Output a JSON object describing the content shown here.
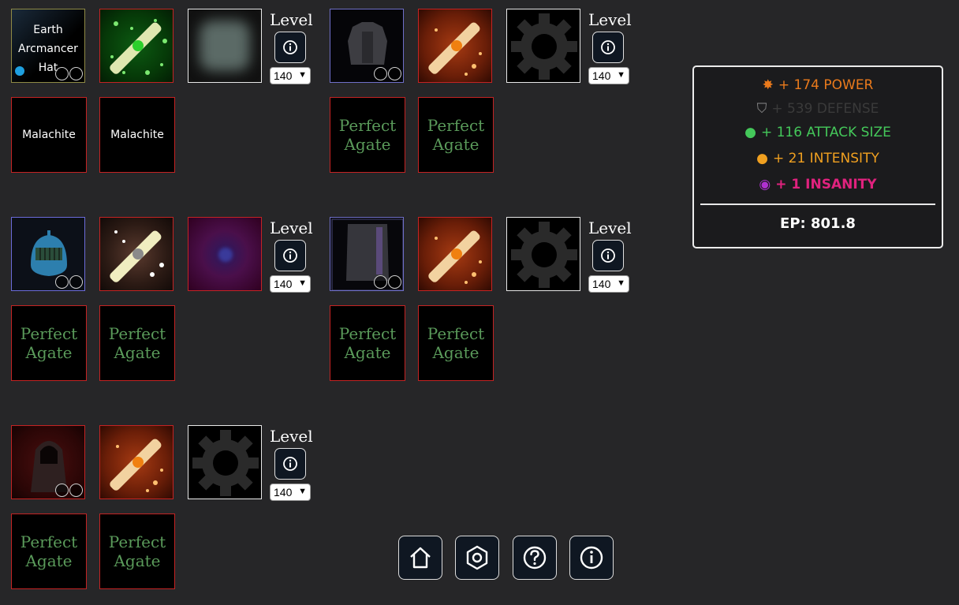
{
  "row1": {
    "hat_label": "Earth Arcmancer Hat",
    "level_label": "Level",
    "level_value": "140",
    "gem1": "Malachite",
    "gem2": "Malachite",
    "gem3": "Perfect Agate",
    "gem4": "Perfect Agate",
    "level2_label": "Level",
    "level2_value": "140"
  },
  "row2": {
    "level_label": "Level",
    "level_value": "140",
    "level2_label": "Level",
    "level2_value": "140",
    "gems": [
      "Perfect Agate",
      "Perfect Agate",
      "Perfect Agate",
      "Perfect Agate"
    ]
  },
  "row3": {
    "level_label": "Level",
    "level_value": "140",
    "gems": [
      "Perfect Agate",
      "Perfect Agate"
    ]
  },
  "stats": {
    "power": "+ 174 POWER",
    "defense": "+ 539 DEFENSE",
    "attack_size": "+ 116 ATTACK SIZE",
    "intensity": "+ 21 INTENSITY",
    "insanity": "+ 1 INSANITY",
    "ep": "EP: 801.8"
  },
  "colors": {
    "power": "#ea7a1c",
    "defense": "#3a3a3a",
    "attack_size": "#44c85a",
    "intensity": "#f0a020",
    "insanity": "#e0227e",
    "slot_border": "#c42323",
    "gem_text": "#5a9a5a"
  },
  "icons": [
    "home-icon",
    "hexagon-settings-icon",
    "question-icon",
    "info-icon"
  ]
}
